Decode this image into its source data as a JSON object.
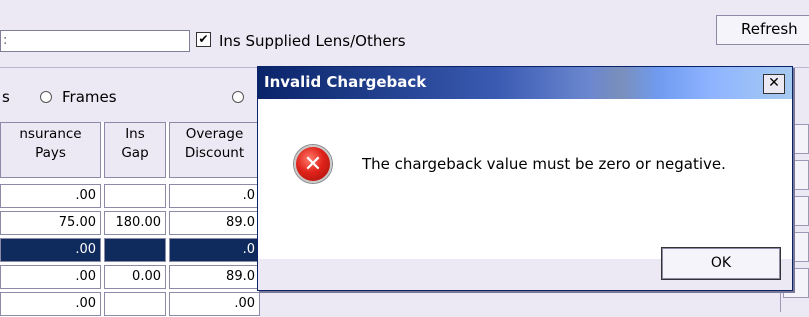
{
  "toolbar": {
    "field_fragment": ":",
    "checkbox_checked": true,
    "checkbox_label": "Ins Supplied Lens/Others",
    "refresh_label": "Refresh"
  },
  "filter": {
    "radio_frames_label": "Frames",
    "radio_prefix_fragment": "s"
  },
  "grid": {
    "headers": [
      {
        "line1": "nsurance",
        "line2": "Pays"
      },
      {
        "line1": "Ins",
        "line2": "Gap"
      },
      {
        "line1": "Overage",
        "line2": "Discount"
      }
    ],
    "rows": [
      [
        ".00",
        "",
        ".0"
      ],
      [
        "75.00",
        "180.00",
        "89.0"
      ],
      [
        ".00",
        "",
        ".0"
      ],
      [
        ".00",
        "0.00",
        "89.0"
      ],
      [
        ".00",
        "",
        ".00"
      ]
    ],
    "selected_row": 2
  },
  "dialog": {
    "title": "Invalid Chargeback",
    "close_glyph": "✕",
    "icon": "error-icon",
    "message": "The chargeback value must be zero or negative.",
    "ok_label": "OK"
  },
  "colors": {
    "selection": "#0f2a5c",
    "titlebar_start": "#0a246a",
    "error_red": "#e0231a"
  }
}
